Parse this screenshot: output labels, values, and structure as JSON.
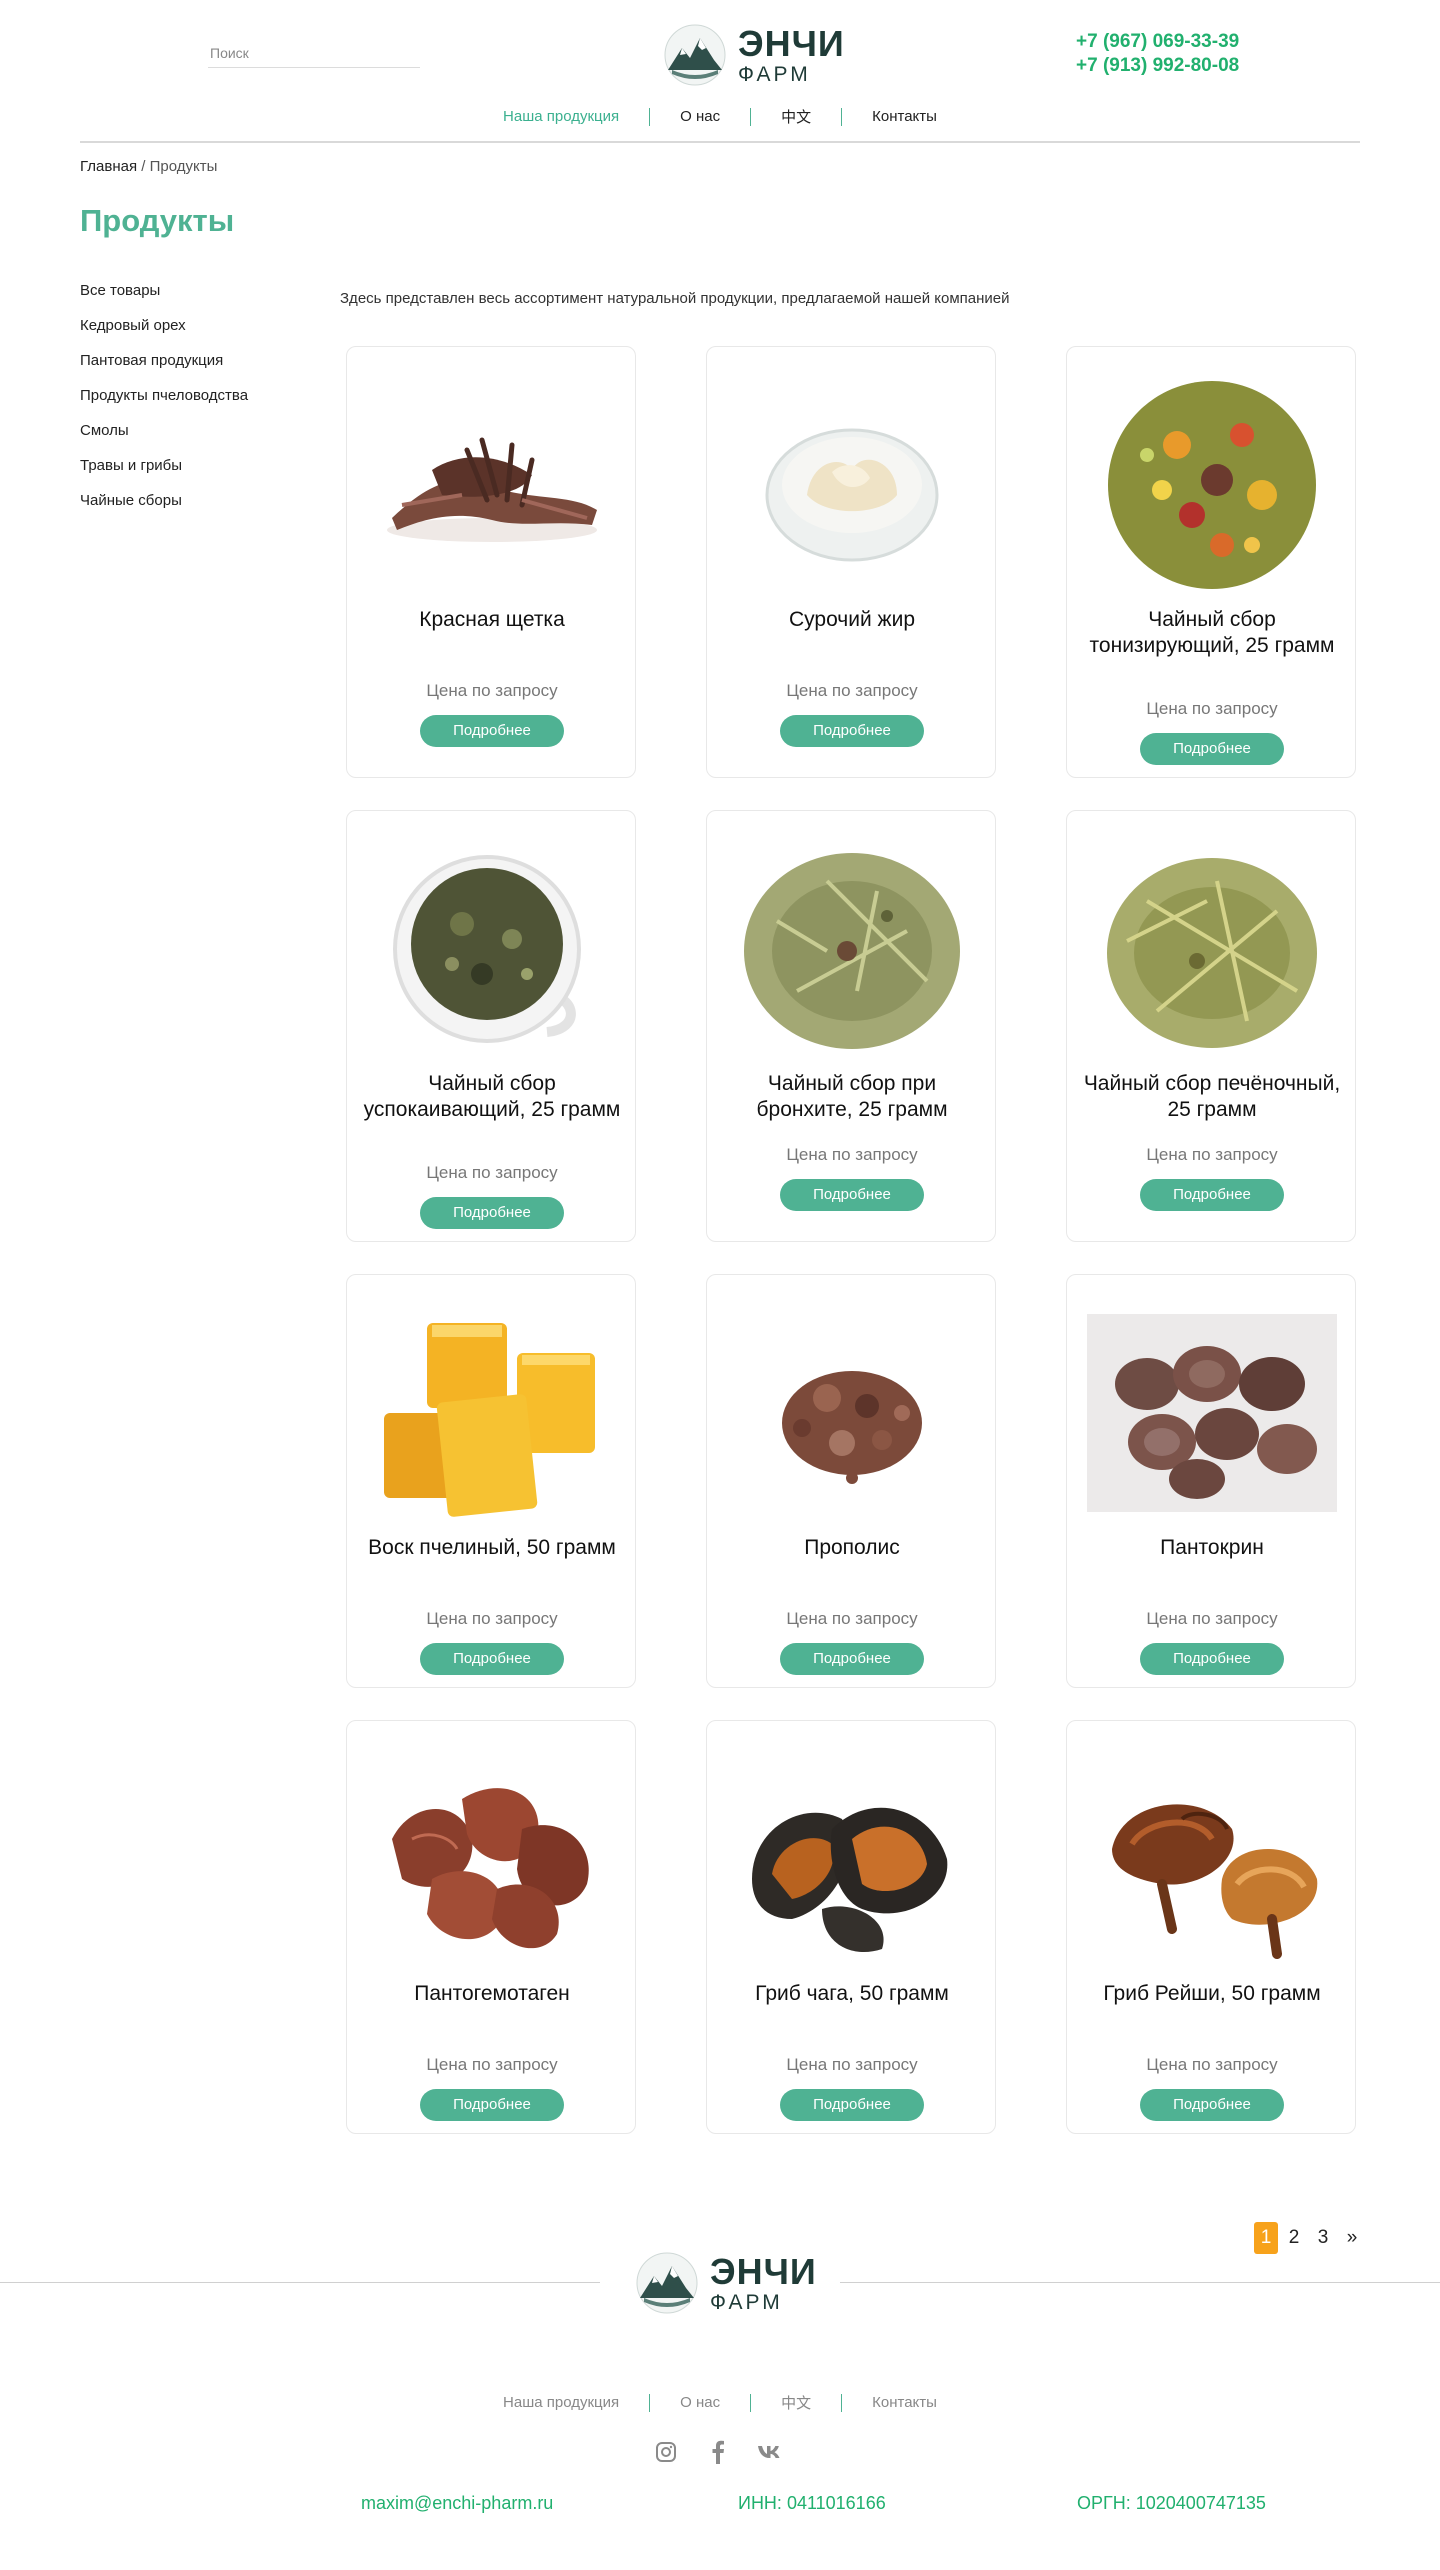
{
  "header": {
    "search_placeholder": "Поиск",
    "brand_name": "ЭНЧИ",
    "brand_sub": "ФАРМ",
    "phones": [
      "+7 (967) 069-33-39",
      "+7 (913) 992-80-08"
    ],
    "nav": [
      "Наша продукция",
      "О нас",
      "中文",
      "Контакты"
    ]
  },
  "breadcrumb": {
    "home": "Главная",
    "separator": " / ",
    "current": "Продукты"
  },
  "page_title": "Продукты",
  "sidebar": [
    "Все товары",
    "Кедровый орех",
    "Пантовая продукция",
    "Продукты пчеловодства",
    "Смолы",
    "Травы и грибы",
    "Чайные сборы"
  ],
  "intro": "Здесь представлен весь ассортимент натуральной продукции, предлагаемой нашей компанией",
  "products": [
    {
      "name": "Красная щетка",
      "price": "Цена по запросу",
      "button": "Подробнее"
    },
    {
      "name": "Сурочий жир",
      "price": "Цена по запросу",
      "button": "Подробнее"
    },
    {
      "name": "Чайный сбор тонизирующий, 25 грамм",
      "price": "Цена по запросу",
      "button": "Подробнее"
    },
    {
      "name": "Чайный сбор успокаивающий, 25 грамм",
      "price": "Цена по запросу",
      "button": "Подробнее"
    },
    {
      "name": "Чайный сбор при бронхите, 25 грамм",
      "price": "Цена по запросу",
      "button": "Подробнее"
    },
    {
      "name": "Чайный сбор печёночный, 25 грамм",
      "price": "Цена по запросу",
      "button": "Подробнее"
    },
    {
      "name": "Воск пчелиный, 50 грамм",
      "price": "Цена по запросу",
      "button": "Подробнее"
    },
    {
      "name": "Прополис",
      "price": "Цена по запросу",
      "button": "Подробнее"
    },
    {
      "name": "Пантокрин",
      "price": "Цена по запросу",
      "button": "Подробнее"
    },
    {
      "name": "Пантогемотаген",
      "price": "Цена по запросу",
      "button": "Подробнее"
    },
    {
      "name": "Гриб чага, 50 грамм",
      "price": "Цена по запросу",
      "button": "Подробнее"
    },
    {
      "name": "Гриб Рейши, 50 грамм",
      "price": "Цена по запросу",
      "button": "Подробнее"
    }
  ],
  "pagination": {
    "pages": [
      "1",
      "2",
      "3"
    ],
    "current": "1",
    "next": "»"
  },
  "footer": {
    "brand_name": "ЭНЧИ",
    "brand_sub": "ФАРМ",
    "nav": [
      "Наша продукция",
      "О нас",
      "中文",
      "Контакты"
    ],
    "social_icons": [
      "instagram-icon",
      "facebook-icon",
      "vk-icon"
    ],
    "email": "maxim@enchi-pharm.ru",
    "inn": "ИНН: 0411016166",
    "ogrn": "ОРГН: 1020400747135"
  },
  "colors": {
    "accent": "#4fb293",
    "phone_green": "#21b06e",
    "page_current": "#f7a21b"
  }
}
